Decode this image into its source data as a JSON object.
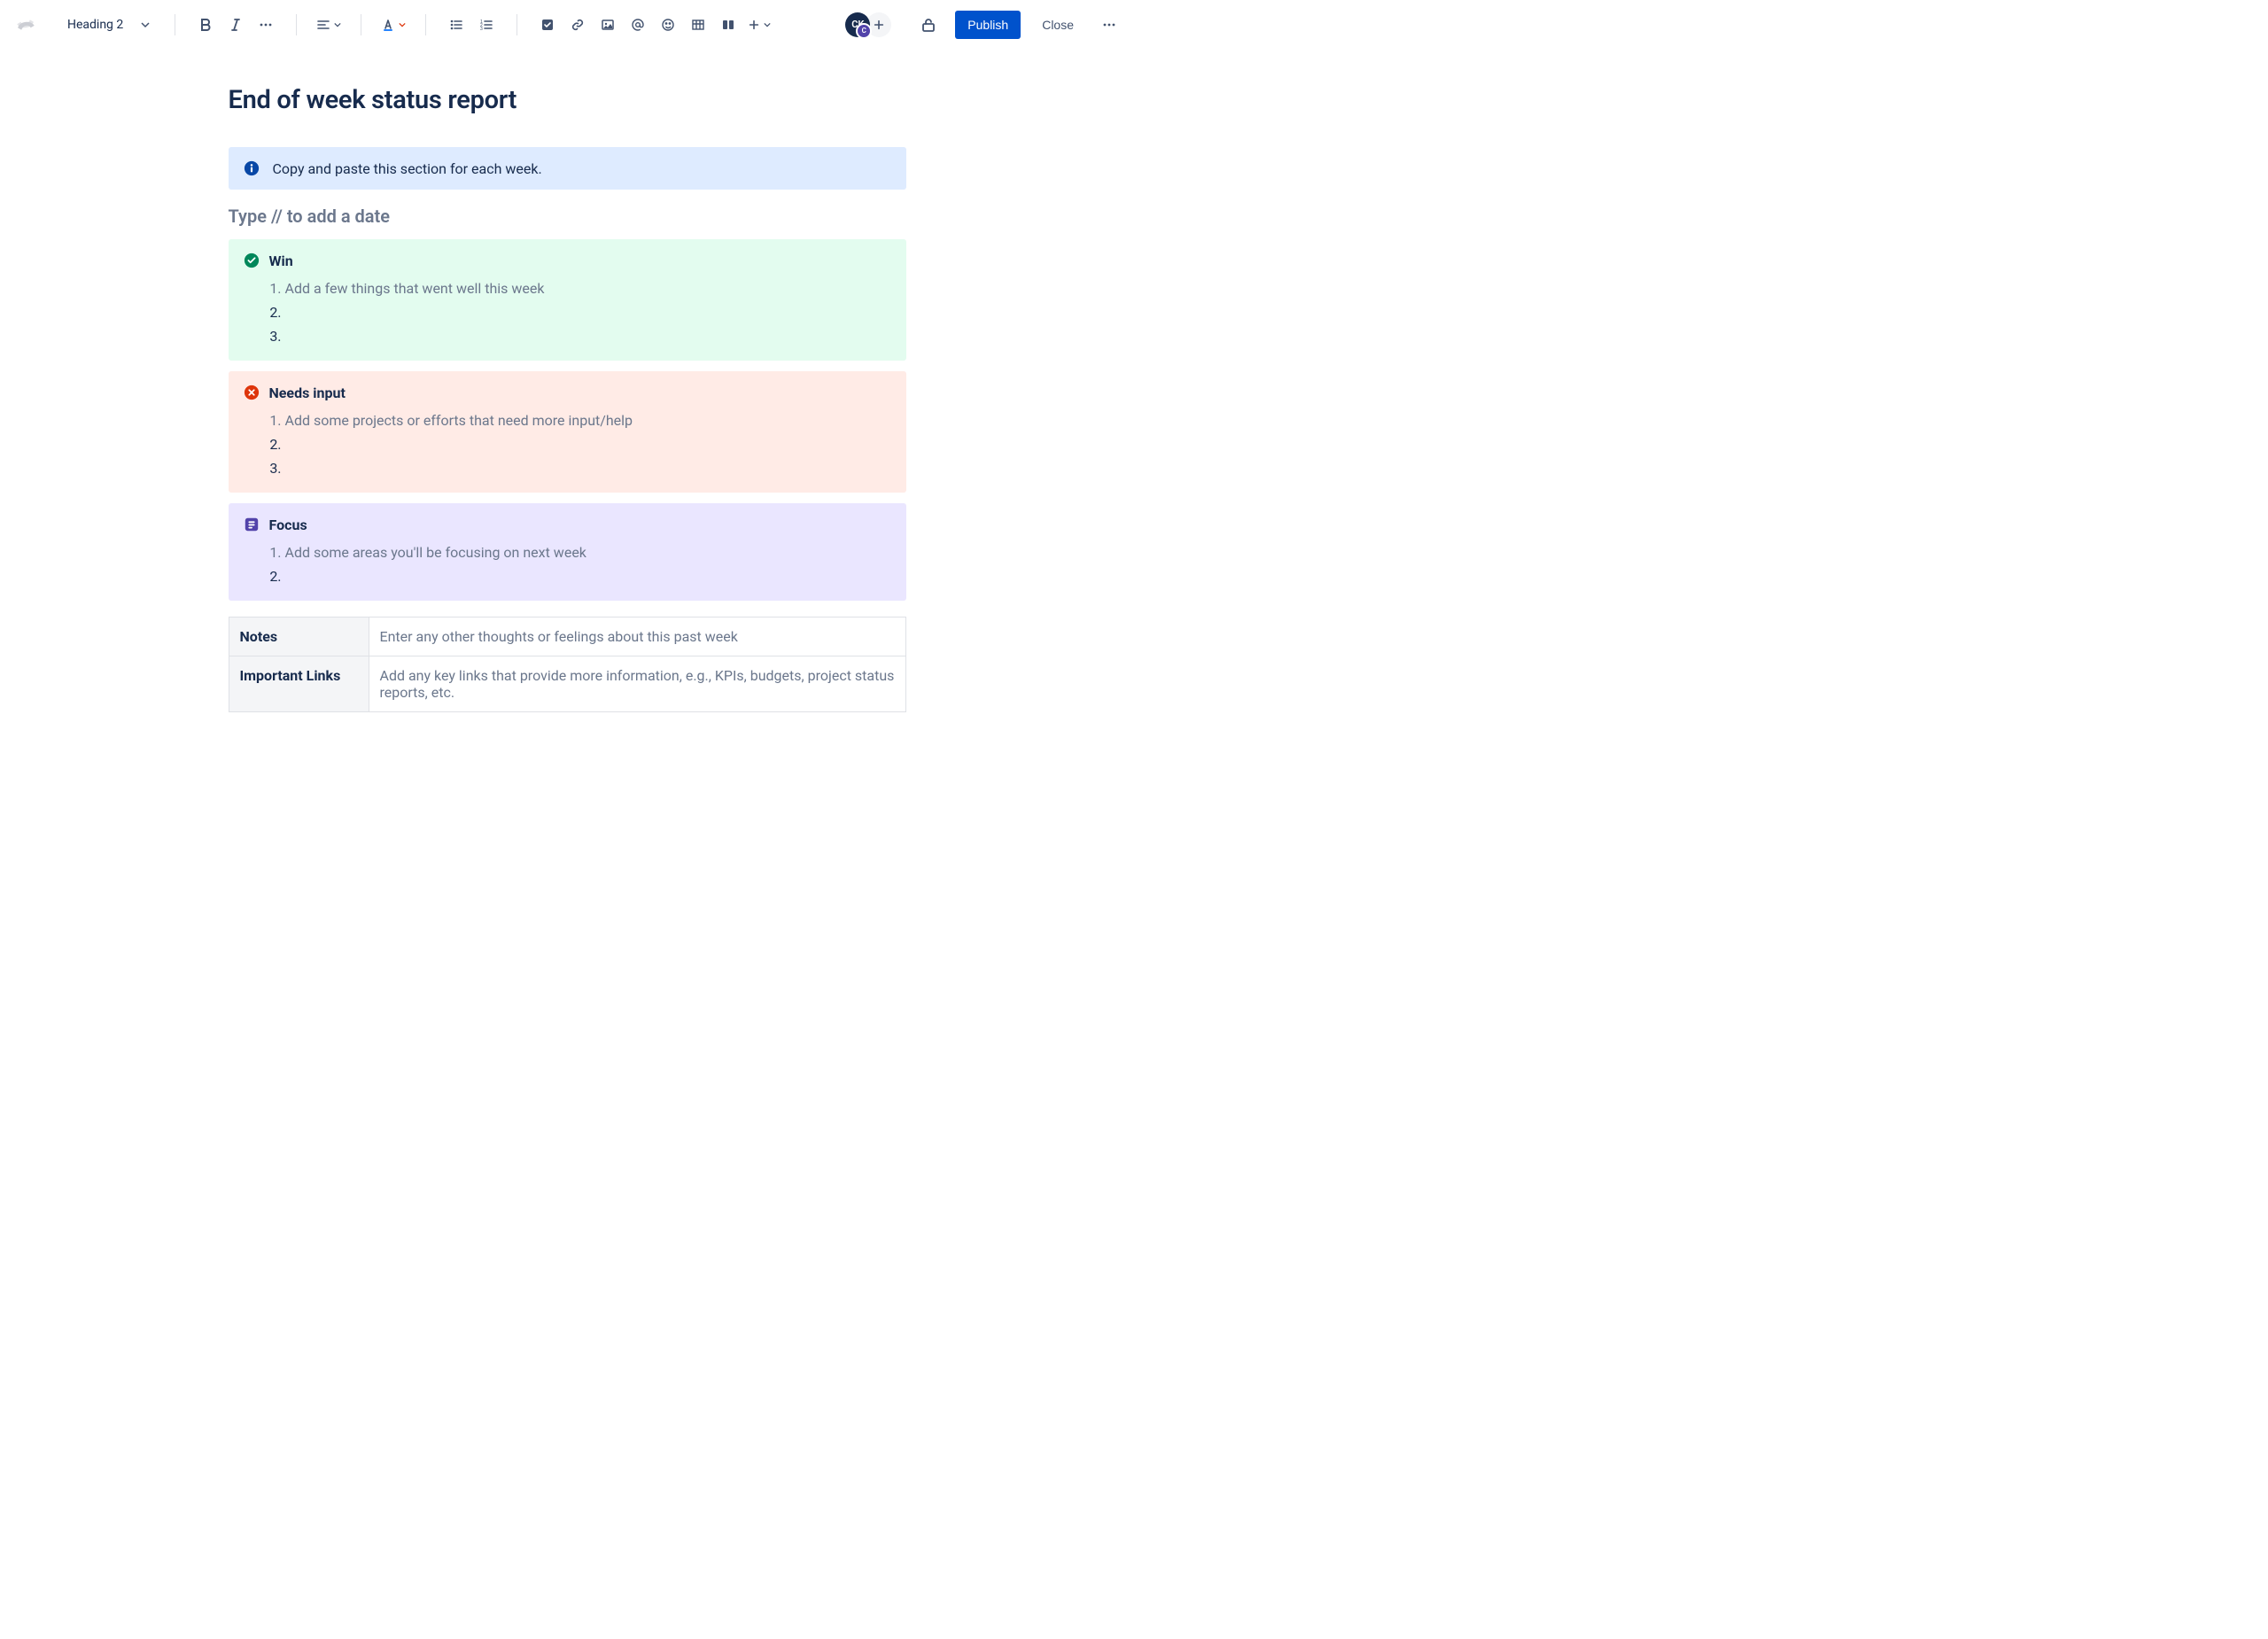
{
  "toolbar": {
    "heading_style": "Heading 2",
    "publish_label": "Publish",
    "close_label": "Close"
  },
  "avatar": {
    "initials": "CK",
    "sub_initial": "C"
  },
  "page": {
    "title": "End of week status report",
    "info_text": "Copy and paste this section for each week.",
    "date_placeholder": "Type // to add a date"
  },
  "panels": {
    "win": {
      "title": "Win",
      "items": [
        "Add a few things that went well this week",
        "",
        ""
      ]
    },
    "needs": {
      "title": "Needs input",
      "items": [
        "Add some projects or efforts that need more input/help",
        "",
        ""
      ]
    },
    "focus": {
      "title": "Focus",
      "items": [
        "Add some areas you'll be focusing on next week",
        ""
      ]
    }
  },
  "table": {
    "rows": [
      {
        "label": "Notes",
        "value": "Enter any other thoughts or feelings about this past week"
      },
      {
        "label": "Important Links",
        "value": "Add any key links that provide more information, e.g., KPIs, budgets, project status reports, etc."
      }
    ]
  }
}
